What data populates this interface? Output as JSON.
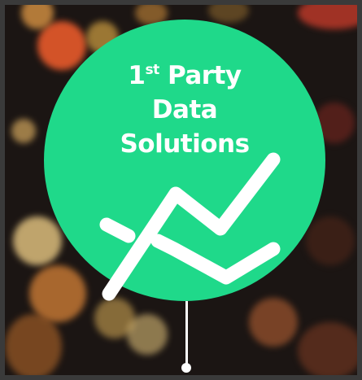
{
  "title": {
    "line1_num": "1",
    "line1_sup": "st",
    "line1_rest": " Party",
    "line2": "Data",
    "line3": "Solutions"
  },
  "colors": {
    "accent": "#1fd98a",
    "text": "#ffffff"
  },
  "icons": [
    "trend-line-icon"
  ]
}
